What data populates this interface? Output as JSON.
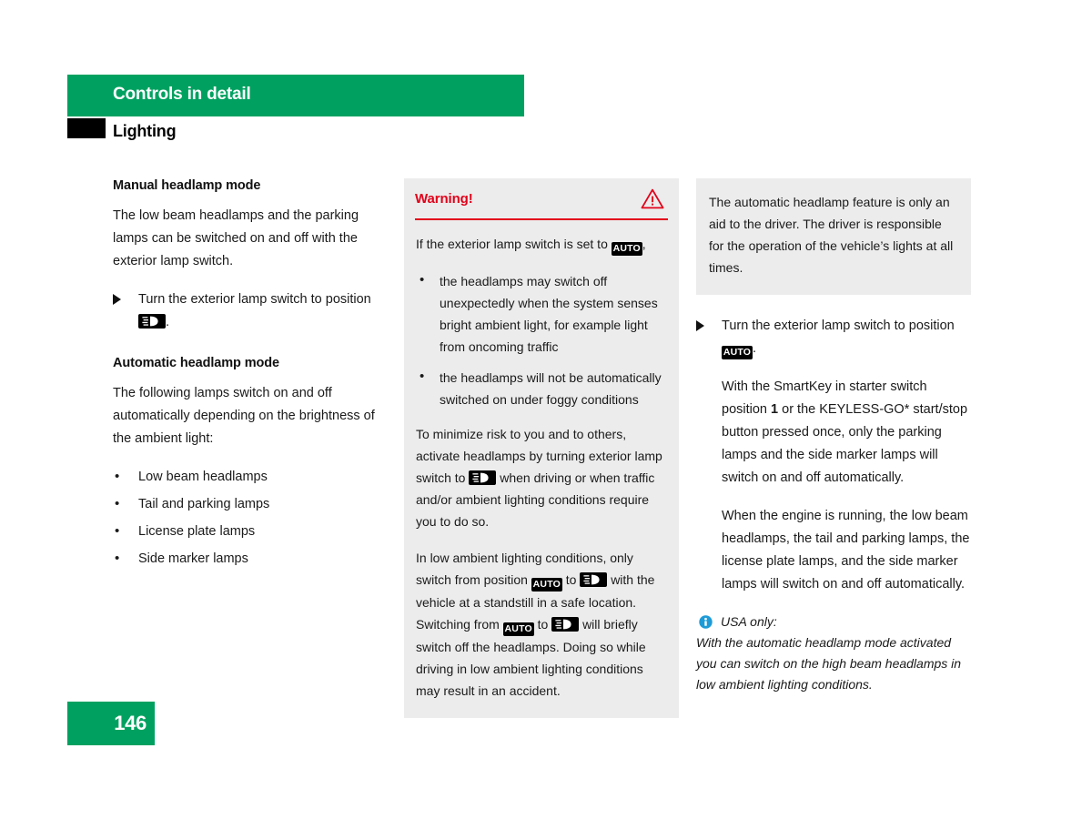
{
  "header": {
    "chapter": "Controls in detail",
    "section": "Lighting",
    "chapter_bar_color": "#00a160",
    "section_marker_color": "#000000"
  },
  "left_column": {
    "manual": {
      "heading": "Manual headlamp mode",
      "paragraph": "The low beam headlamps and the parking lamps can be switched on and off with the exterior lamp switch.",
      "step_prefix": "Turn the exterior lamp switch to position",
      "step_badge": "low-beam-badge",
      "step_suffix": "."
    },
    "automatic": {
      "heading": "Automatic headlamp mode",
      "paragraph": "The following lamps switch on and off automatically depending on the brightness of the ambient light:",
      "items": [
        "Low beam headlamps",
        "Tail and parking lamps",
        "License plate lamps",
        "Side marker lamps"
      ]
    }
  },
  "warning": {
    "title": "Warning!",
    "title_color": "#e2001a",
    "rule_color": "#e2001a",
    "background_color": "#ececec",
    "icon": "warning-triangle-icon",
    "intro_prefix": "If the exterior lamp switch is set to",
    "intro_badge": "AUTO",
    "intro_suffix": ",",
    "bullets": [
      "the headlamps may switch off unexpectedly when the system senses bright ambient light, for example light from oncoming traffic",
      "the headlamps will not be automatically switched on under foggy conditions"
    ],
    "para2_part1": "To minimize risk to you and to others, activate headlamps by turning exterior lamp switch to",
    "para2_part2": "when driving or when traffic and/or ambient lighting conditions require you to do so.",
    "para3_part1": "In low ambient lighting conditions, only switch from position",
    "para3_badge1": "AUTO",
    "para3_part2": "to",
    "para3_part3": "with the vehicle at a standstill in a safe location. Switching from",
    "para3_badge2": "AUTO",
    "para3_part4": "to",
    "para3_part5": "will briefly switch off the headlamps. Doing so while driving in low ambient lighting conditions may result in an accident."
  },
  "right_column": {
    "grey_note": "The automatic headlamp feature is only an aid to the driver. The driver is responsible for the operation of the vehicle’s lights at all times.",
    "step_prefix": "Turn the exterior lamp switch to position",
    "step_badge": "AUTO",
    "step_suffix": ".",
    "paragraph_smartkey_part1": "With the SmartKey in starter switch position",
    "paragraph_smartkey_bold": "1",
    "paragraph_smartkey_part2": "or the KEYLESS-GO* start/stop button pressed once, only the parking lamps and the side marker lamps will switch on and off automatically.",
    "paragraph_engine": "When the engine is running, the low beam headlamps, the tail and parking lamps, the license plate lamps, and the side marker lamps will switch on and off automatically.",
    "usa_note": {
      "icon": "info-icon",
      "icon_color": "#1e9bd7",
      "heading": "USA only:",
      "body": "With the automatic headlamp mode activated you can switch on the high beam headlamps in low ambient lighting conditions."
    }
  },
  "footer": {
    "page_number": "146",
    "box_color": "#00a160"
  }
}
